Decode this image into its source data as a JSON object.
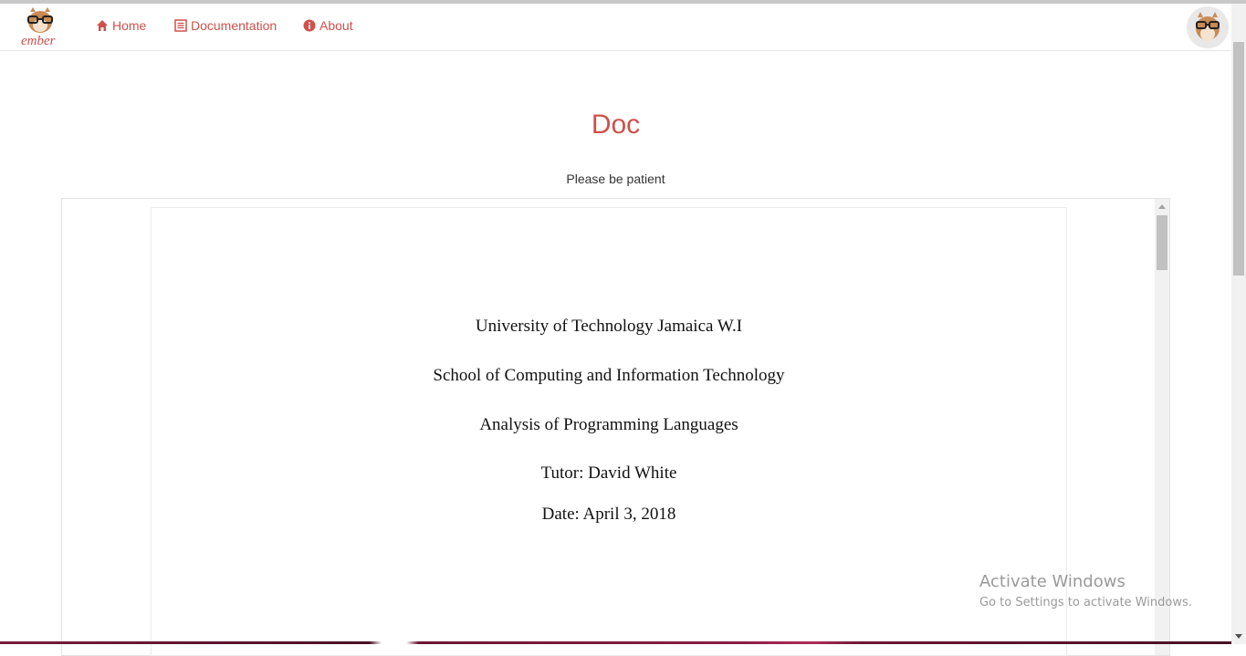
{
  "navbar": {
    "logo_alt": "ember",
    "links": [
      {
        "label": "Home",
        "icon": "home-icon"
      },
      {
        "label": "Documentation",
        "icon": "list-icon"
      },
      {
        "label": "About",
        "icon": "info-icon"
      }
    ]
  },
  "main": {
    "title": "Doc",
    "subtitle": "Please be patient"
  },
  "document": {
    "lines": [
      "University of Technology Jamaica W.I",
      "School of Computing and Information Technology",
      "Analysis of Programming Languages",
      "Tutor: David White",
      "Date: April 3, 2018"
    ]
  },
  "watermark": {
    "title": "Activate Windows",
    "subtitle": "Go to Settings to activate Windows."
  },
  "colors": {
    "accent": "#d0504a",
    "text": "#333333"
  }
}
